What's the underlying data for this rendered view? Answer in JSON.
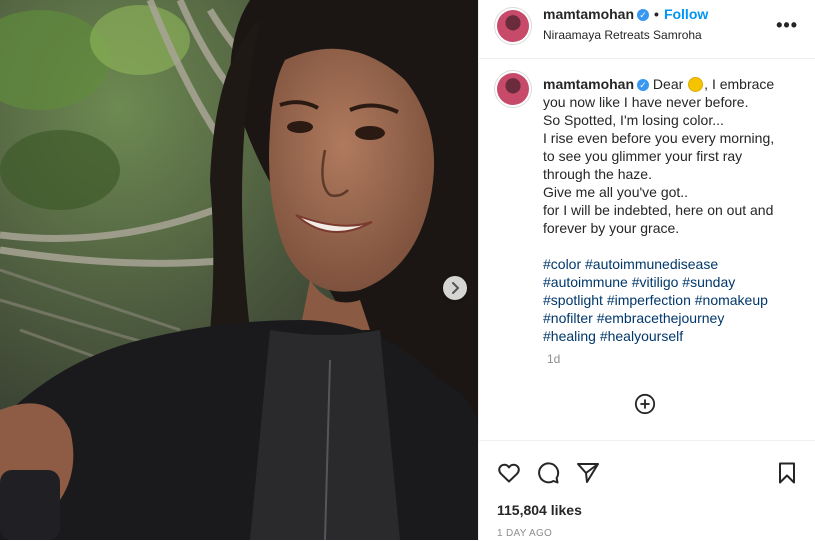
{
  "header": {
    "username": "mamtamohan",
    "separator": "•",
    "follow_label": "Follow",
    "location": "Niraamaya Retreats Samroha",
    "more_label": "•••"
  },
  "caption": {
    "username": "mamtamohan",
    "line1_pre": "Dear",
    "line1_post": ", I embrace",
    "lines": [
      "you now like I have never before.",
      "So Spotted, I'm losing color...",
      "I rise even before you every morning,",
      "to see you glimmer your first ray",
      "through the haze.",
      "Give me all you've got..",
      "for I will be indebted, here on out and",
      "forever by your grace."
    ],
    "hashtag_lines": [
      "#color #autoimmunedisease",
      "#autoimmune #vitiligo #sunday",
      "#spotlight #imperfection #nomakeup",
      "#nofilter #embracethejourney",
      "#healing #healyourself"
    ],
    "time": "1d"
  },
  "footer": {
    "likes": "115,804 likes",
    "posted": "1 DAY AGO"
  },
  "icons": {
    "verified": "verified-badge-icon",
    "like": "heart-icon",
    "comment": "comment-icon",
    "share": "paper-plane-icon",
    "save": "bookmark-icon",
    "add": "plus-circle-icon",
    "next": "chevron-right-icon"
  },
  "colors": {
    "link": "#0095f6",
    "hashtag": "#00376b",
    "muted": "#8e8e8e"
  }
}
